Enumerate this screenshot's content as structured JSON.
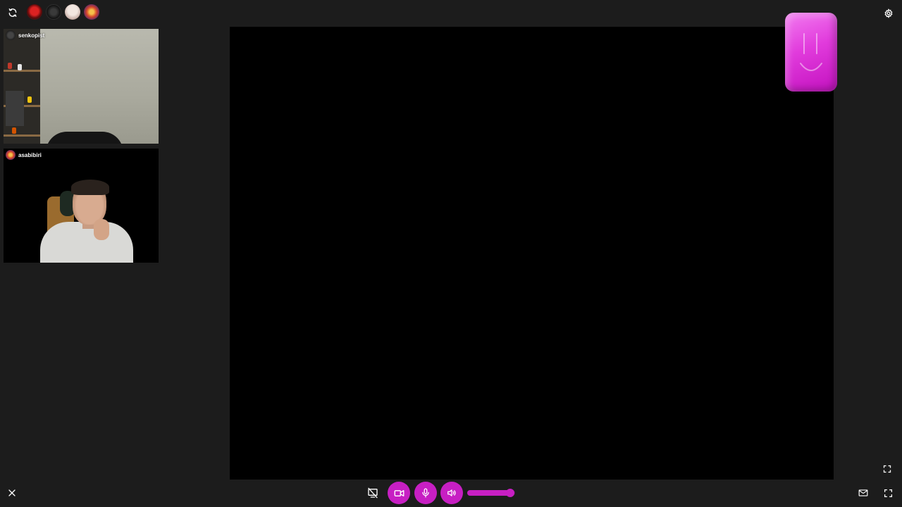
{
  "topbar": {
    "refresh_icon": "refresh-icon",
    "participant_avatars": [
      {
        "icon": "avatar-red-mask"
      },
      {
        "icon": "avatar-dark-emblem"
      },
      {
        "icon": "avatar-white-portrait"
      },
      {
        "icon": "avatar-colorful-badge"
      }
    ],
    "settings_icon": "gear-icon"
  },
  "participants": [
    {
      "name": "senkopist"
    },
    {
      "name": "asabibiri"
    }
  ],
  "controls": {
    "screen_share_icon": "screen-share-off-icon",
    "camera_icon": "video-camera-icon",
    "mic_icon": "microphone-icon",
    "speaker_icon": "speaker-icon",
    "volume_level": 0.9
  },
  "colors": {
    "accent": "#c71fc3",
    "background": "#1c1c1c",
    "stage": "#000000"
  }
}
